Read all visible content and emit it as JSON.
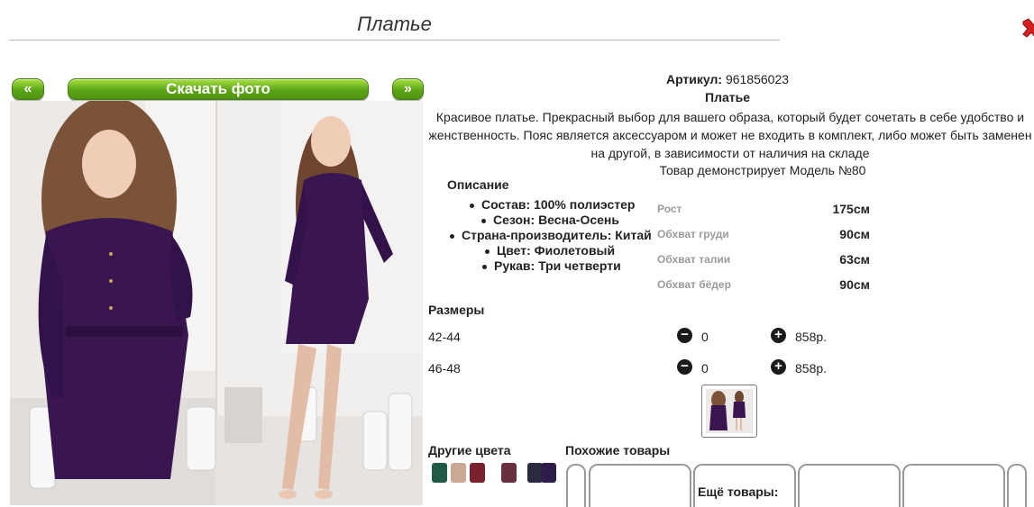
{
  "header": {
    "title": "Платье"
  },
  "nav": {
    "prev": "«",
    "download": "Скачать фото",
    "next": "»"
  },
  "product": {
    "article_label": "Артикул:",
    "article_value": "961856023",
    "name": "Платье",
    "description": "Красивое платье. Прекрасный выбор для вашего образа, который будет сочетать в себе удобство и женственность. Пояс является аксессуаром и может не входить в комплект, либо может быть заменен на другой, в зависимости от наличия на складе",
    "model_note": "Товар демонстрирует Модель №80"
  },
  "specs": {
    "heading": "Описание",
    "items": [
      "Состав: 100% полиэстер",
      "Сезон: Весна-Осень",
      "Страна-производитель: Китай",
      "Цвет: Фиолетовый",
      "Рукав: Три четверти"
    ]
  },
  "measurements": [
    {
      "label": "Рост",
      "value": "175см"
    },
    {
      "label": "Обхват груди",
      "value": "90см"
    },
    {
      "label": "Обхват талии",
      "value": "63см"
    },
    {
      "label": "Обхват бёдер",
      "value": "90см"
    }
  ],
  "sizes": {
    "heading": "Размеры",
    "rows": [
      {
        "size": "42-44",
        "qty": "0",
        "price": "858р."
      },
      {
        "size": "46-48",
        "qty": "0",
        "price": "858р."
      }
    ]
  },
  "sections": {
    "other_colors": "Другие цвета",
    "similar": "Похожие товары",
    "more": "Ещё товары:"
  },
  "colors": {
    "dress_purple": "#3a1650",
    "button_green": "#5ca416",
    "other_color_swatches": [
      "#1f5a45",
      "#caa894",
      "#7a2130",
      "#6a3040",
      "#2a2a40",
      "#2e1d4a"
    ]
  },
  "icons": {
    "close": "close-icon",
    "minus": "minus-icon",
    "plus": "plus-icon"
  }
}
